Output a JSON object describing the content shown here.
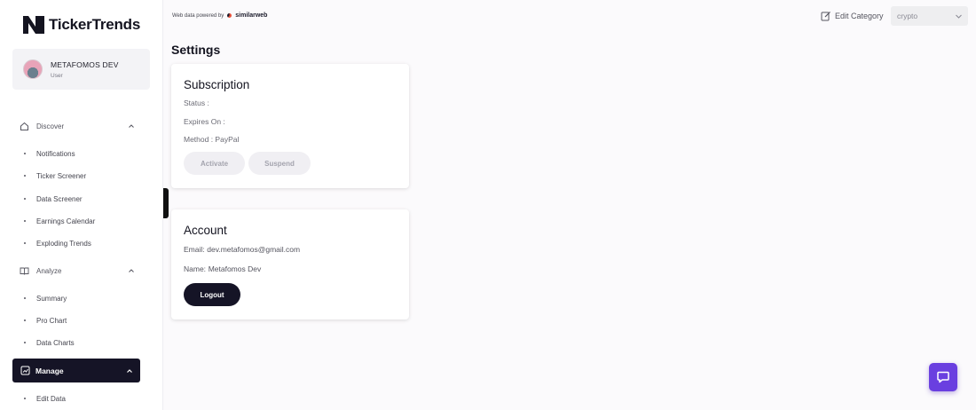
{
  "app": {
    "logo_text": "TickerTrends"
  },
  "user": {
    "name": "METAFOMOS DEV",
    "role": "User"
  },
  "sidebar": {
    "discover": {
      "label": "Discover",
      "items": [
        "Notifications",
        "Ticker Screener",
        "Data Screener",
        "Earnings Calendar",
        "Exploding Trends"
      ]
    },
    "analyze": {
      "label": "Analyze",
      "items": [
        "Summary",
        "Pro Chart",
        "Data Charts"
      ]
    },
    "manage": {
      "label": "Manage",
      "items": [
        "Edit Data"
      ]
    }
  },
  "topbar": {
    "powered_by": "Web data powered by",
    "powered_brand": "similarweb",
    "edit_category_label": "Edit Category",
    "category_value": "crypto"
  },
  "page": {
    "title": "Settings"
  },
  "subscription": {
    "title": "Subscription",
    "status": "Status :",
    "expires": "Expires On :",
    "method": "Method : PayPal",
    "activate_label": "Activate",
    "suspend_label": "Suspend"
  },
  "account": {
    "title": "Account",
    "email_label": "Email:",
    "email_value": "dev.metafomos@gmail.com",
    "name_label": "Name:",
    "name_value": "Metafomos Dev",
    "logout_label": "Logout"
  },
  "colors": {
    "dark": "#151426",
    "accent_chat": "#6a3fe0"
  }
}
